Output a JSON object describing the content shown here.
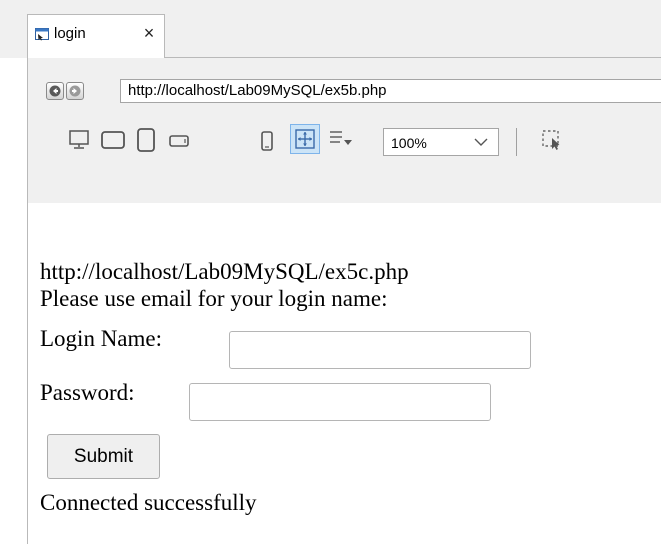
{
  "tab": {
    "title": "login",
    "close_glyph": "×",
    "icon": "browser-page-icon"
  },
  "address_bar": {
    "url": "http://localhost/Lab09MySQL/ex5b.php"
  },
  "toolbar": {
    "device_icons": [
      "desktop-icon",
      "tablet-landscape-icon",
      "tablet-portrait-icon",
      "phone-landscape-icon",
      "phone-portrait-icon",
      "fit-to-window-icon",
      "wrap-lines-icon"
    ],
    "zoom": "100%",
    "inspect_icon": "inspect-select-icon"
  },
  "page": {
    "redirect_url": "http://localhost/Lab09MySQL/ex5c.php",
    "instruction": "Please use email for your login name:",
    "login_label": "Login Name:",
    "password_label": "Password:",
    "submit_label": "Submit",
    "status": "Connected successfully"
  },
  "colors": {
    "chrome_bg": "#f0f0f0",
    "active_tool_bg": "#cce4f7",
    "active_tool_border": "#7eb4ea"
  }
}
